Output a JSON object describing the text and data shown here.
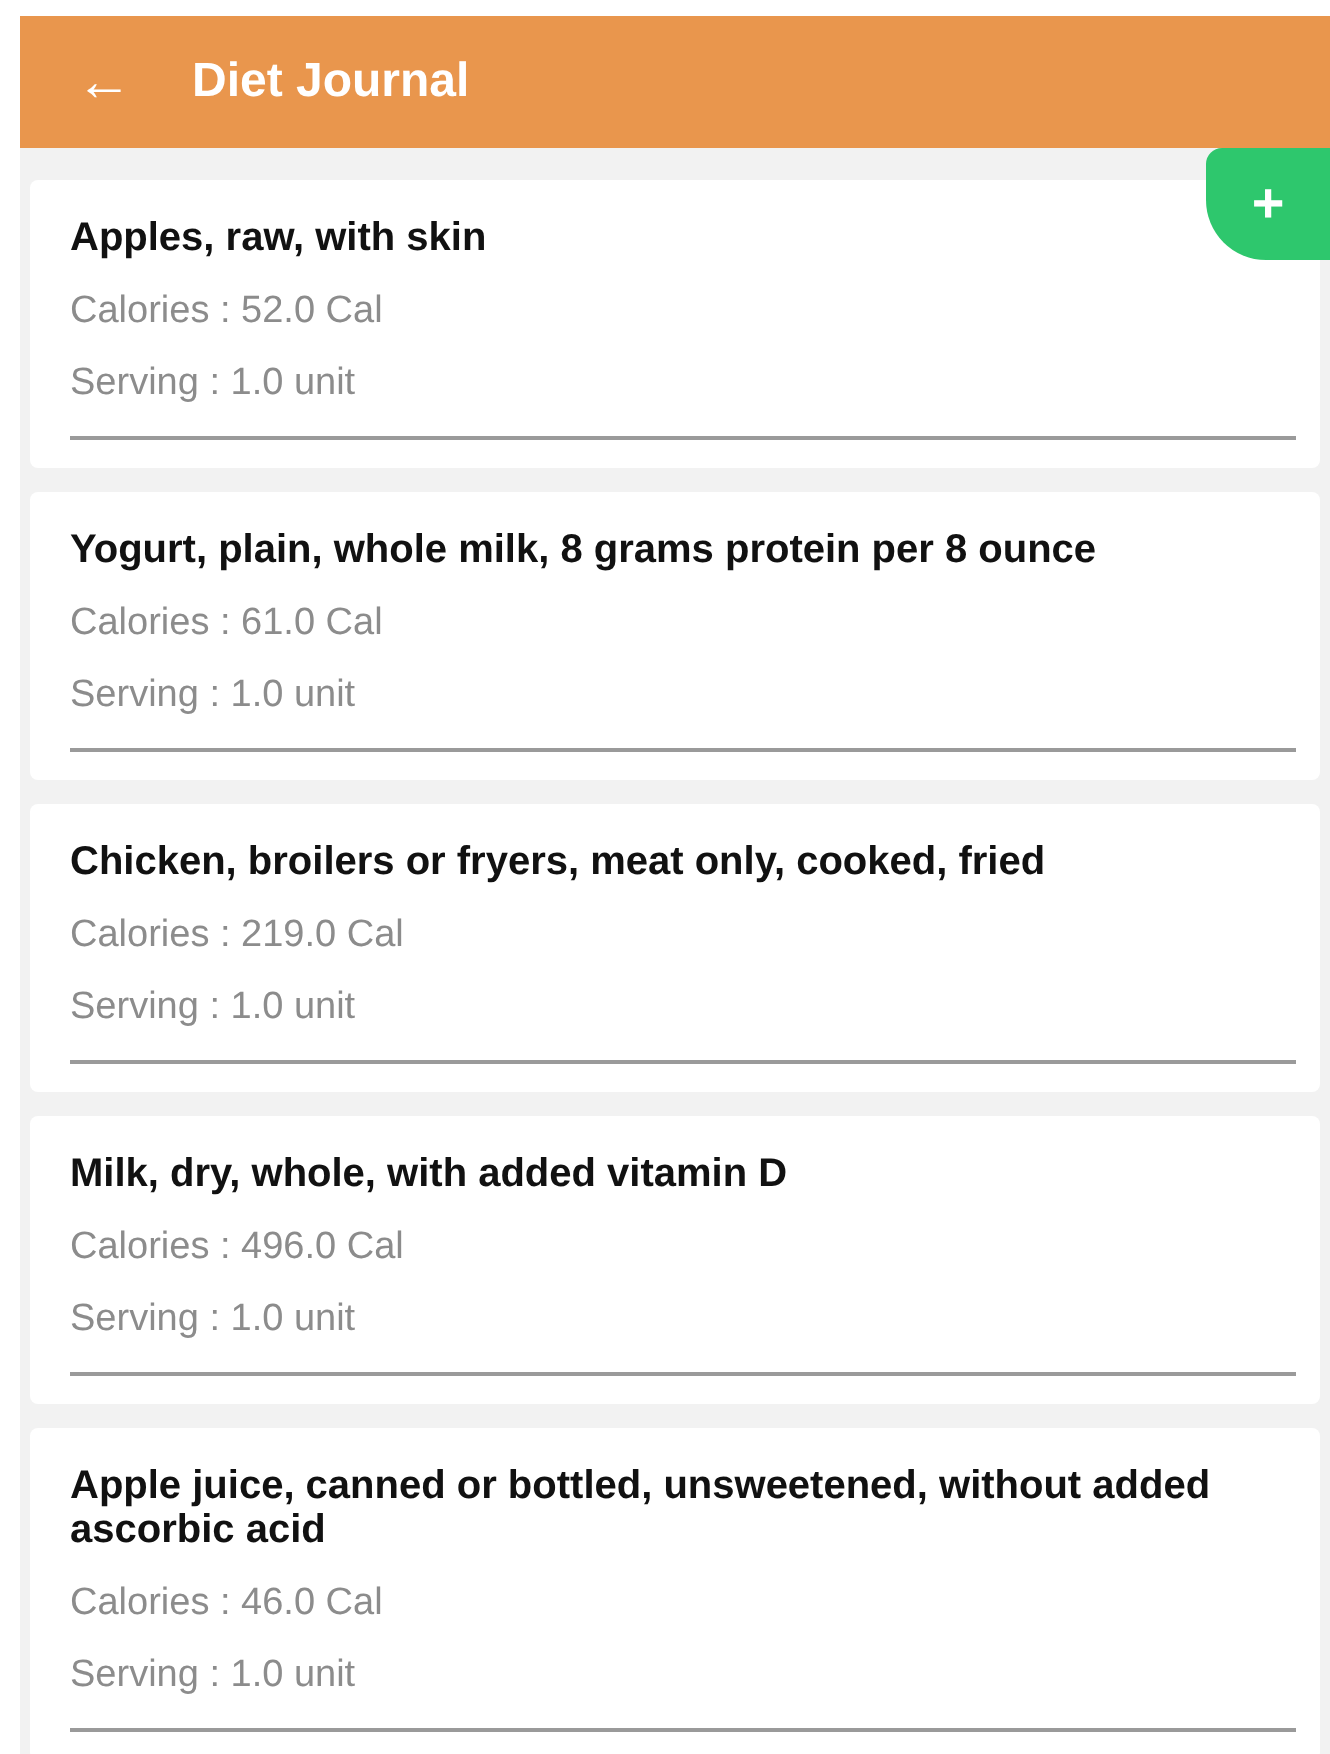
{
  "app_bar": {
    "back_icon": "←",
    "title": "Diet Journal"
  },
  "add_button": {
    "label": "+"
  },
  "entries": [
    {
      "name": "Apples, raw, with skin",
      "calories": "Calories : 52.0 Cal",
      "serving": "Serving : 1.0 unit"
    },
    {
      "name": "Yogurt, plain, whole milk, 8 grams protein per 8 ounce",
      "calories": "Calories : 61.0 Cal",
      "serving": "Serving : 1.0 unit"
    },
    {
      "name": "Chicken, broilers or fryers, meat only, cooked, fried",
      "calories": "Calories : 219.0 Cal",
      "serving": "Serving : 1.0 unit"
    },
    {
      "name": "Milk, dry, whole, with added vitamin D",
      "calories": "Calories : 496.0 Cal",
      "serving": "Serving : 1.0 unit"
    },
    {
      "name": "Apple juice, canned or bottled, unsweetened, without added ascorbic acid",
      "calories": "Calories : 46.0 Cal",
      "serving": "Serving : 1.0 unit"
    }
  ]
}
